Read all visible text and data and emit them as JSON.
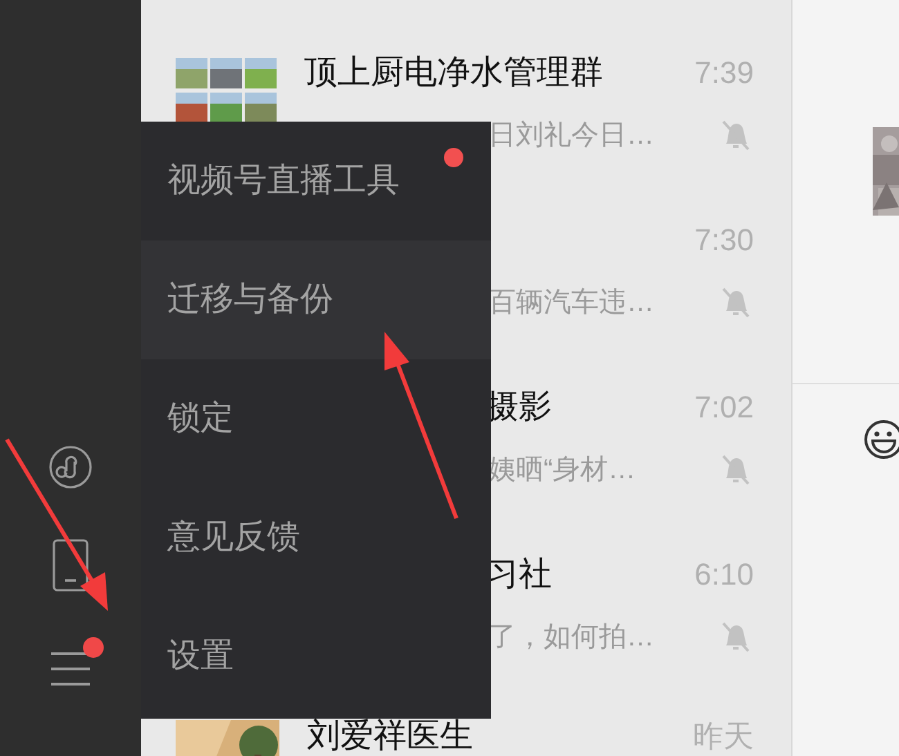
{
  "sidebar": {
    "icons": [
      {
        "kind": "mini-program"
      },
      {
        "kind": "phone"
      },
      {
        "kind": "menu",
        "badge": true
      }
    ]
  },
  "chats": [
    {
      "title": "顶上厨电净水管理群",
      "time": "7:39",
      "preview": "日刘礼今日…",
      "preview_cut": true,
      "muted": true,
      "kind": "group"
    },
    {
      "time": "7:30",
      "preview": "百辆汽车违…",
      "preview_cut": true,
      "muted": true,
      "kind": "covered"
    },
    {
      "title": "摄影",
      "title_cut": true,
      "time": "7:02",
      "preview": "姨晒“身材…",
      "preview_cut": true,
      "muted": true,
      "kind": "covered"
    },
    {
      "title": "习社",
      "title_cut": true,
      "time": "6:10",
      "preview": "了，如何拍…",
      "preview_cut": true,
      "muted": true,
      "kind": "covered"
    },
    {
      "title": "刘爱祥医生",
      "time": "昨天",
      "kind": "contact"
    }
  ],
  "menu": {
    "items": [
      {
        "label": "视频号直播工具",
        "badge": true,
        "highlighted": false
      },
      {
        "label": "迁移与备份",
        "badge": false,
        "highlighted": true
      },
      {
        "label": "锁定",
        "badge": false,
        "highlighted": false
      },
      {
        "label": "意见反馈",
        "badge": false,
        "highlighted": false
      },
      {
        "label": "设置",
        "badge": false,
        "highlighted": false
      }
    ]
  }
}
